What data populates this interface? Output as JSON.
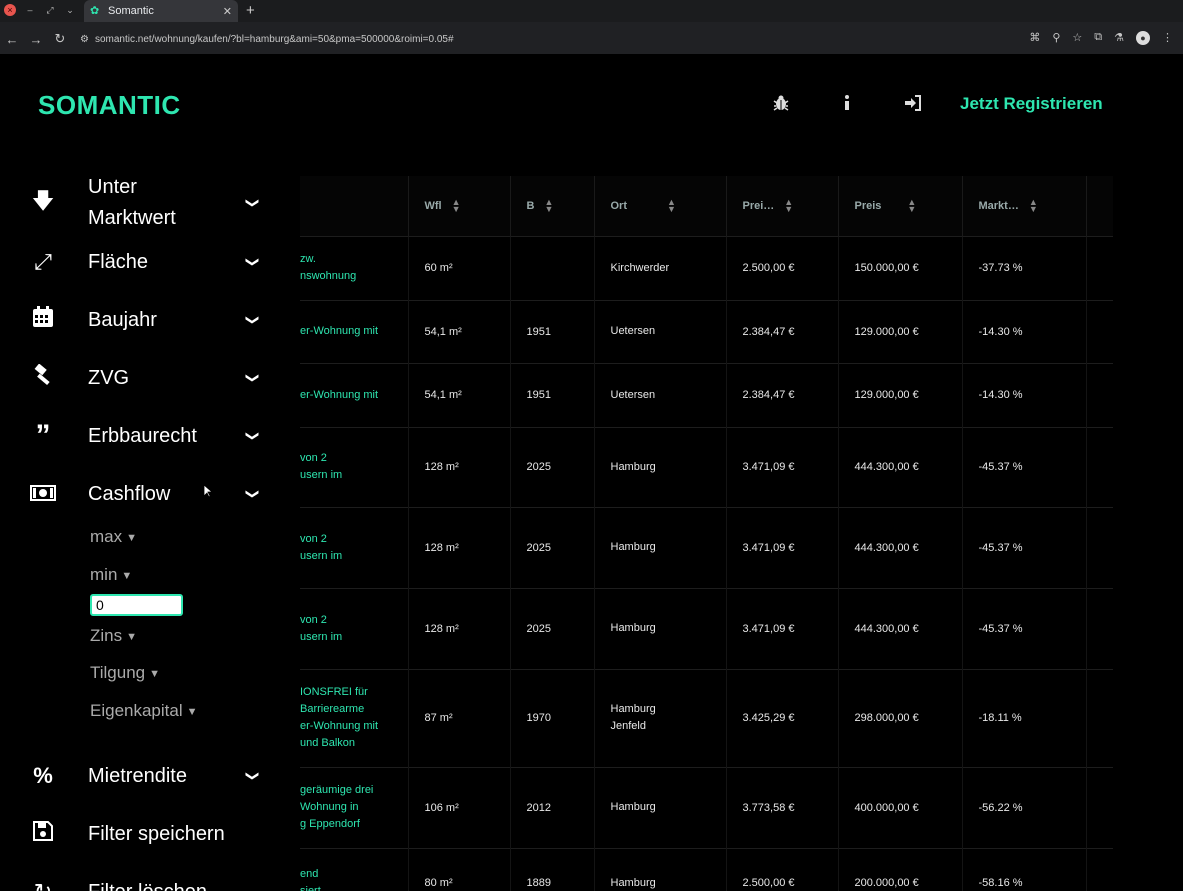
{
  "browser": {
    "tab_title": "Somantic",
    "url": "somantic.net/wohnung/kaufen/?bl=hamburg&ami=50&pma=500000&roimi=0.05#"
  },
  "header": {
    "logo": "SOMANTIC",
    "register": "Jetzt Registrieren"
  },
  "sidebar": {
    "items": [
      {
        "label_line1": "Unter",
        "label_line2": "Marktwert",
        "icon": "arrow-down-icon"
      },
      {
        "label": "Fläche",
        "icon": "expand-icon"
      },
      {
        "label": "Baujahr",
        "icon": "calendar-icon"
      },
      {
        "label": "ZVG",
        "icon": "gavel-icon"
      },
      {
        "label": "Erbbaurecht",
        "icon": "quote-icon"
      },
      {
        "label": "Cashflow",
        "icon": "money-bill-icon"
      },
      {
        "label": "Mietrendite",
        "icon": "percent-icon"
      },
      {
        "label": "Filter speichern",
        "icon": "save-icon"
      },
      {
        "label": "Filter löschen",
        "icon": "reset-icon"
      }
    ],
    "cashflow_sub": {
      "max": "max",
      "min": "min",
      "min_value": "0",
      "zins": "Zins",
      "tilgung": "Tilgung",
      "eigenkapital": "Eigenkapital"
    }
  },
  "table": {
    "headers": [
      "Wfl",
      "B",
      "Ort",
      "Prei…",
      "Preis",
      "Markt…"
    ],
    "rows": [
      {
        "title": "zw. nswohnung",
        "wfl": "60 m²",
        "baujahr": "",
        "ort": "Kirchwerder",
        "qm_preis": "2.500,00 €",
        "preis": "150.000,00 €",
        "markt": "-37.73 %"
      },
      {
        "title": "er-Wohnung mit",
        "wfl": "54,1 m²",
        "baujahr": "1951",
        "ort": "Uetersen",
        "qm_preis": "2.384,47 €",
        "preis": "129.000,00 €",
        "markt": "-14.30 %"
      },
      {
        "title": "er-Wohnung mit",
        "wfl": "54,1 m²",
        "baujahr": "1951",
        "ort": "Uetersen",
        "qm_preis": "2.384,47 €",
        "preis": "129.000,00 €",
        "markt": "-14.30 %"
      },
      {
        "title": "von 2 usern im",
        "wfl": "128 m²",
        "baujahr": "2025",
        "ort": "Hamburg",
        "qm_preis": "3.471,09 €",
        "preis": "444.300,00 €",
        "markt": "-45.37 %"
      },
      {
        "title": "von 2 usern im",
        "wfl": "128 m²",
        "baujahr": "2025",
        "ort": "Hamburg",
        "qm_preis": "3.471,09 €",
        "preis": "444.300,00 €",
        "markt": "-45.37 %"
      },
      {
        "title": "von 2 usern im",
        "wfl": "128 m²",
        "baujahr": "2025",
        "ort": "Hamburg",
        "qm_preis": "3.471,09 €",
        "preis": "444.300,00 €",
        "markt": "-45.37 %"
      },
      {
        "title": "IONSFREI für Barrierearme er-Wohnung mit und Balkon",
        "wfl": "87 m²",
        "baujahr": "1970",
        "ort": "Hamburg Jenfeld",
        "qm_preis": "3.425,29 €",
        "preis": "298.000,00 €",
        "markt": "-18.11 %"
      },
      {
        "title": "geräumige drei Wohnung in g Eppendorf",
        "wfl": "106 m²",
        "baujahr": "2012",
        "ort": "Hamburg",
        "qm_preis": "3.773,58 €",
        "preis": "400.000,00 €",
        "markt": "-56.22 %"
      },
      {
        "title": "end siert",
        "wfl": "80 m²",
        "baujahr": "1889",
        "ort": "Hamburg",
        "qm_preis": "2.500,00 €",
        "preis": "200.000,00 €",
        "markt": "-58.16 %"
      }
    ]
  }
}
